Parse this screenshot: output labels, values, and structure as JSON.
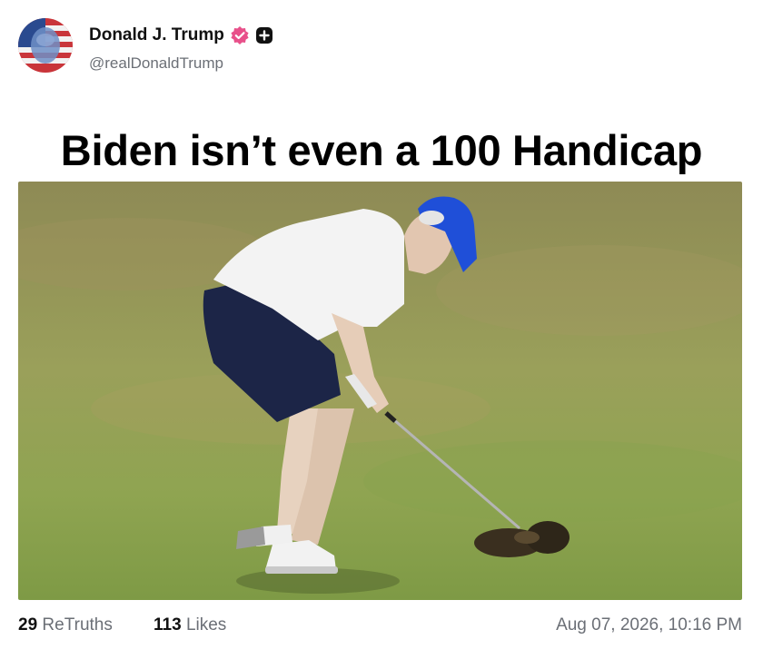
{
  "post": {
    "author": {
      "display_name": "Donald J. Trump",
      "handle": "@realDonaldTrump",
      "verified_icon": "verified-badge-icon",
      "extra_icon": "plus-square-icon"
    },
    "headline": "Biden isn’t even a 100 Handicap",
    "stats": {
      "retruths_count": "29",
      "retruths_label": "ReTruths",
      "likes_count": "113",
      "likes_label": "Likes"
    },
    "timestamp": "Aug 07, 2026, 10:16 PM"
  },
  "colors": {
    "verified_badge": "#e8508a",
    "muted_text": "#6b6f76",
    "cap_blue": "#1f4fd8",
    "grass": "#8c9a4f"
  }
}
